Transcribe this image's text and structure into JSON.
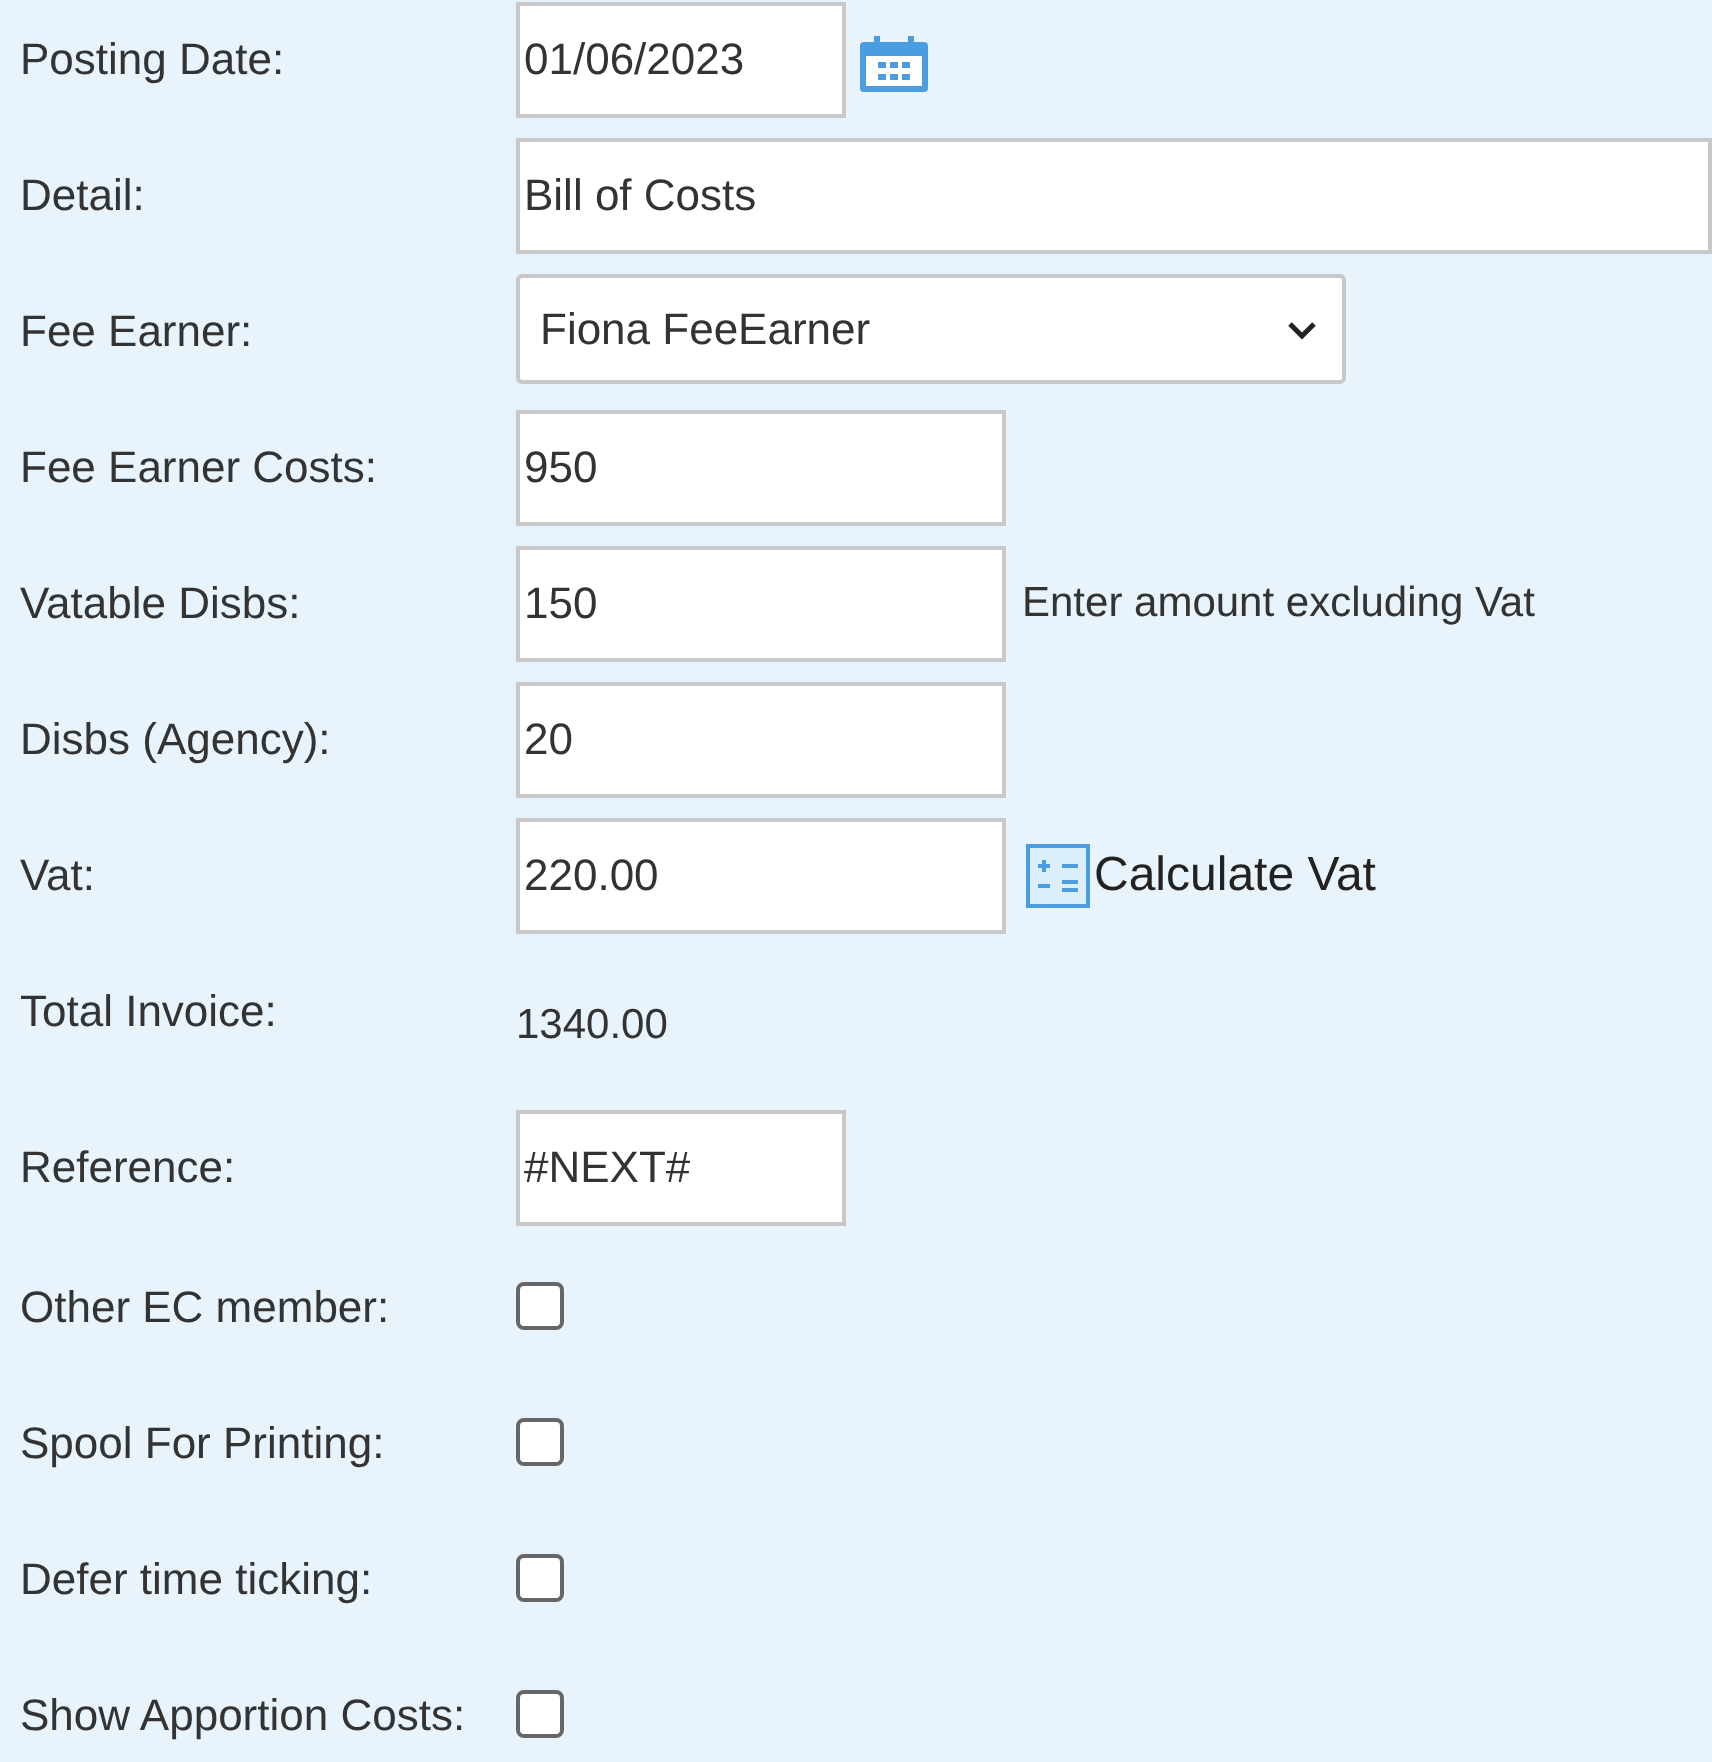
{
  "fields": [
    {
      "kind": "date",
      "label": "Posting Date:",
      "value": "01/06/2023"
    },
    {
      "kind": "wide",
      "label": "Detail:",
      "value": "Bill of Costs"
    },
    {
      "kind": "select",
      "label": "Fee Earner:",
      "value": "Fiona FeeEarner"
    },
    {
      "kind": "text",
      "label": "Fee Earner Costs:",
      "value": "950"
    },
    {
      "kind": "text",
      "label": "Vatable Disbs:",
      "value": "150",
      "hint": "Enter amount excluding Vat"
    },
    {
      "kind": "text",
      "label": "Disbs (Agency):",
      "value": "20"
    },
    {
      "kind": "calc",
      "label": "Vat:",
      "value": "220.00",
      "action": "Calculate Vat"
    },
    {
      "kind": "static",
      "label": "Total Invoice:",
      "value": "1340.00"
    },
    {
      "kind": "short",
      "label": "Reference:",
      "value": "#NEXT#"
    },
    {
      "kind": "checkbox",
      "label": "Other EC member:",
      "checked": false
    },
    {
      "kind": "checkbox",
      "label": "Spool For Printing:",
      "checked": false
    },
    {
      "kind": "checkbox",
      "label": "Defer time ticking:",
      "checked": false
    },
    {
      "kind": "checkbox",
      "label": "Show Apportion Costs:",
      "checked": false
    }
  ]
}
